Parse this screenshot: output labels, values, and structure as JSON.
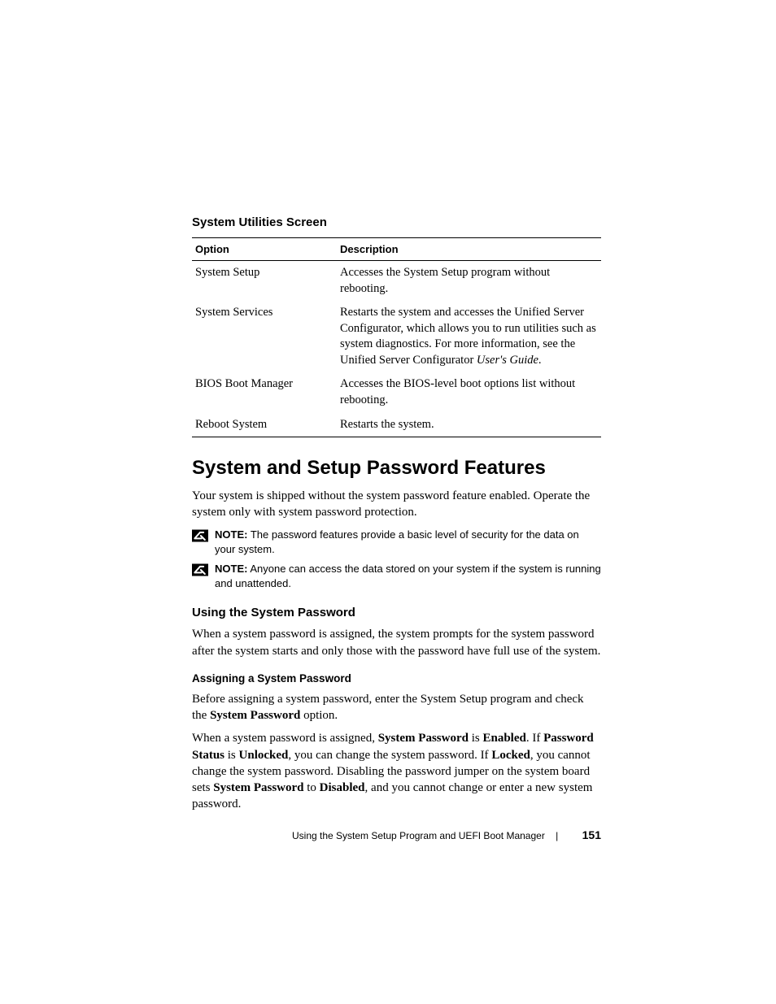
{
  "section1": {
    "heading": "System Utilities Screen",
    "th_option": "Option",
    "th_desc": "Description",
    "rows": [
      {
        "option": "System Setup",
        "desc": "Accesses the System Setup program without rebooting."
      },
      {
        "option": "System Services",
        "desc_pre": "Restarts the system and accesses the Unified Server Configurator, which allows you to run utilities such as system diagnostics. For more information, see the Unified Server Configurator ",
        "desc_italic": "User's Guide",
        "desc_post": "."
      },
      {
        "option": "BIOS Boot Manager",
        "desc": "Accesses the BIOS-level boot options list without rebooting."
      },
      {
        "option": "Reboot System",
        "desc": "Restarts the system."
      }
    ]
  },
  "h1": "System and Setup Password Features",
  "intro": "Your system is shipped without the system password feature enabled. Operate the system only with system password protection.",
  "note_label": "NOTE:",
  "note1": " The password features provide a basic level of security for the data on your system.",
  "note2": " Anyone can access the data stored on your system if the system is running and unattended.",
  "h2": "Using the System Password",
  "p2": "When a system password is assigned, the system prompts for the system password after the system starts and only those with the password have full use of the system.",
  "h3": "Assigning a System Password",
  "p3a_pre": "Before assigning a system password, enter the System Setup program and check the ",
  "p3a_b1": "System Password",
  "p3a_post": " option.",
  "p3b": {
    "t1": "When a system password is assigned, ",
    "b1": "System Password",
    "t2": " is ",
    "b2": "Enabled",
    "t3": ". If ",
    "b3": "Password Status",
    "t4": " is ",
    "b4": "Unlocked",
    "t5": ", you can change the system password. If ",
    "b5": "Locked",
    "t6": ", you cannot change the system password. Disabling the password jumper on the system board sets ",
    "b6": "System Password",
    "t7": " to ",
    "b7": "Disabled",
    "t8": ", and you cannot change or enter a new system password."
  },
  "footer": {
    "title": "Using the System Setup Program and UEFI Boot Manager",
    "page": "151"
  }
}
